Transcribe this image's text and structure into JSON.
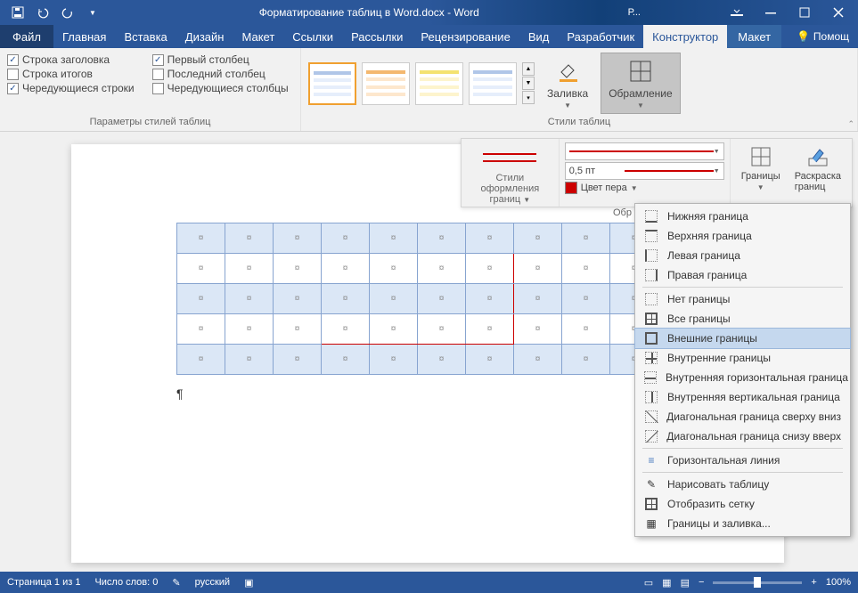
{
  "title": "Форматирование таблиц в Word.docx - Word",
  "account_hint": "Р...",
  "ribbon_tabs": {
    "file": "Файл",
    "tabs": [
      "Главная",
      "Вставка",
      "Дизайн",
      "Макет",
      "Ссылки",
      "Рассылки",
      "Рецензирование",
      "Вид",
      "Разработчик"
    ],
    "context_active": "Конструктор",
    "context2": "Макет",
    "help": "Помощ"
  },
  "group1": {
    "label": "Параметры стилей таблиц",
    "c1": "Строка заголовка",
    "c2": "Строка итогов",
    "c3": "Чередующиеся строки",
    "c4": "Первый столбец",
    "c5": "Последний столбец",
    "c6": "Чередующиеся столбцы"
  },
  "group2": {
    "label": "Стили таблиц",
    "fill": "Заливка",
    "border": "Обрамление"
  },
  "sub": {
    "styles_label": "Стили оформления границ",
    "width": "0,5 пт",
    "pen": "Цвет пера",
    "borders": "Границы",
    "painter": "Раскраска границ",
    "truncated": "Обр"
  },
  "dropdown": {
    "items": [
      "Нижняя граница",
      "Верхняя граница",
      "Левая граница",
      "Правая граница",
      "Нет границы",
      "Все границы",
      "Внешние границы",
      "Внутренние границы",
      "Внутренняя горизонтальная граница",
      "Внутренняя вертикальная граница",
      "Диагональная граница сверху вниз",
      "Диагональная граница снизу вверх"
    ],
    "hline": "Горизонтальная линия",
    "draw": "Нарисовать таблицу",
    "grid": "Отобразить сетку",
    "more": "Границы и заливка..."
  },
  "status": {
    "page": "Страница 1 из 1",
    "words": "Число слов: 0",
    "lang": "русский",
    "zoom": "100%"
  },
  "table_cell": "¤",
  "para": "¶"
}
